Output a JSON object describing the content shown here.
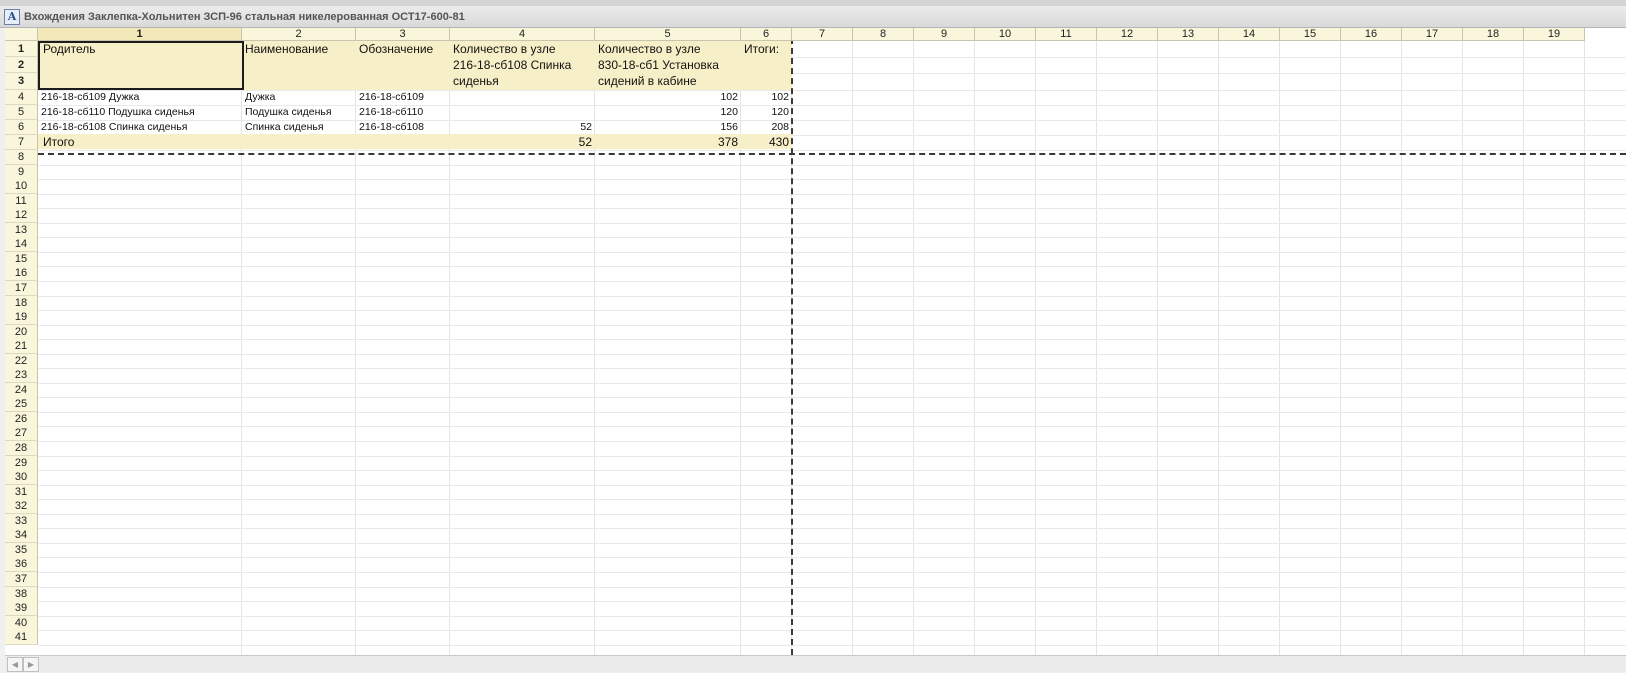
{
  "window": {
    "title": "Вхождения Заклепка-Хольнитен ЗСП-96 стальная никелерованная ОСТ17-600-81",
    "icon": "spreadsheet-a-icon"
  },
  "columns": [
    "1",
    "2",
    "3",
    "4",
    "5",
    "6",
    "7",
    "8",
    "9",
    "10",
    "11",
    "12",
    "13",
    "14",
    "15",
    "16",
    "17",
    "18",
    "19"
  ],
  "rows": [
    "1",
    "2",
    "3",
    "4",
    "5",
    "6",
    "7",
    "8",
    "9",
    "10",
    "11",
    "12",
    "13",
    "14",
    "15",
    "16",
    "17",
    "18",
    "19",
    "20",
    "21",
    "22",
    "23",
    "24",
    "25",
    "26",
    "27",
    "28",
    "29",
    "30",
    "31",
    "32",
    "33",
    "34",
    "35",
    "36",
    "37",
    "38",
    "39",
    "40",
    "41"
  ],
  "header": {
    "parent": "Родитель",
    "name": "Наименование",
    "designation": "Обозначение",
    "qty1_line1": "Количество в узле",
    "qty1_line2": "216-18-сб108 Спинка",
    "qty1_line3": "сиденья",
    "qty2_line1": "Количество в узле",
    "qty2_line2": "830-18-сб1 Установка",
    "qty2_line3": "сидений в кабине",
    "totals": "Итоги:"
  },
  "table_rows": [
    {
      "parent": "216-18-сб109 Дужка",
      "name": "Дужка",
      "designation": "216-18-сб109",
      "qty1": "",
      "qty2": "102",
      "total": "102"
    },
    {
      "parent": "216-18-сб110 Подушка сиденья",
      "name": "Подушка сиденья",
      "designation": "216-18-сб110",
      "qty1": "",
      "qty2": "120",
      "total": "120"
    },
    {
      "parent": "216-18-сб108 Спинка сиденья",
      "name": "Спинка сиденья",
      "designation": "216-18-сб108",
      "qty1": "52",
      "qty2": "156",
      "total": "208"
    }
  ],
  "footer": {
    "label": "Итого",
    "qty1": "52",
    "qty2": "378",
    "total": "430"
  },
  "scroll": {
    "left_icon": "scroll-left-icon",
    "right_icon": "scroll-right-icon"
  }
}
